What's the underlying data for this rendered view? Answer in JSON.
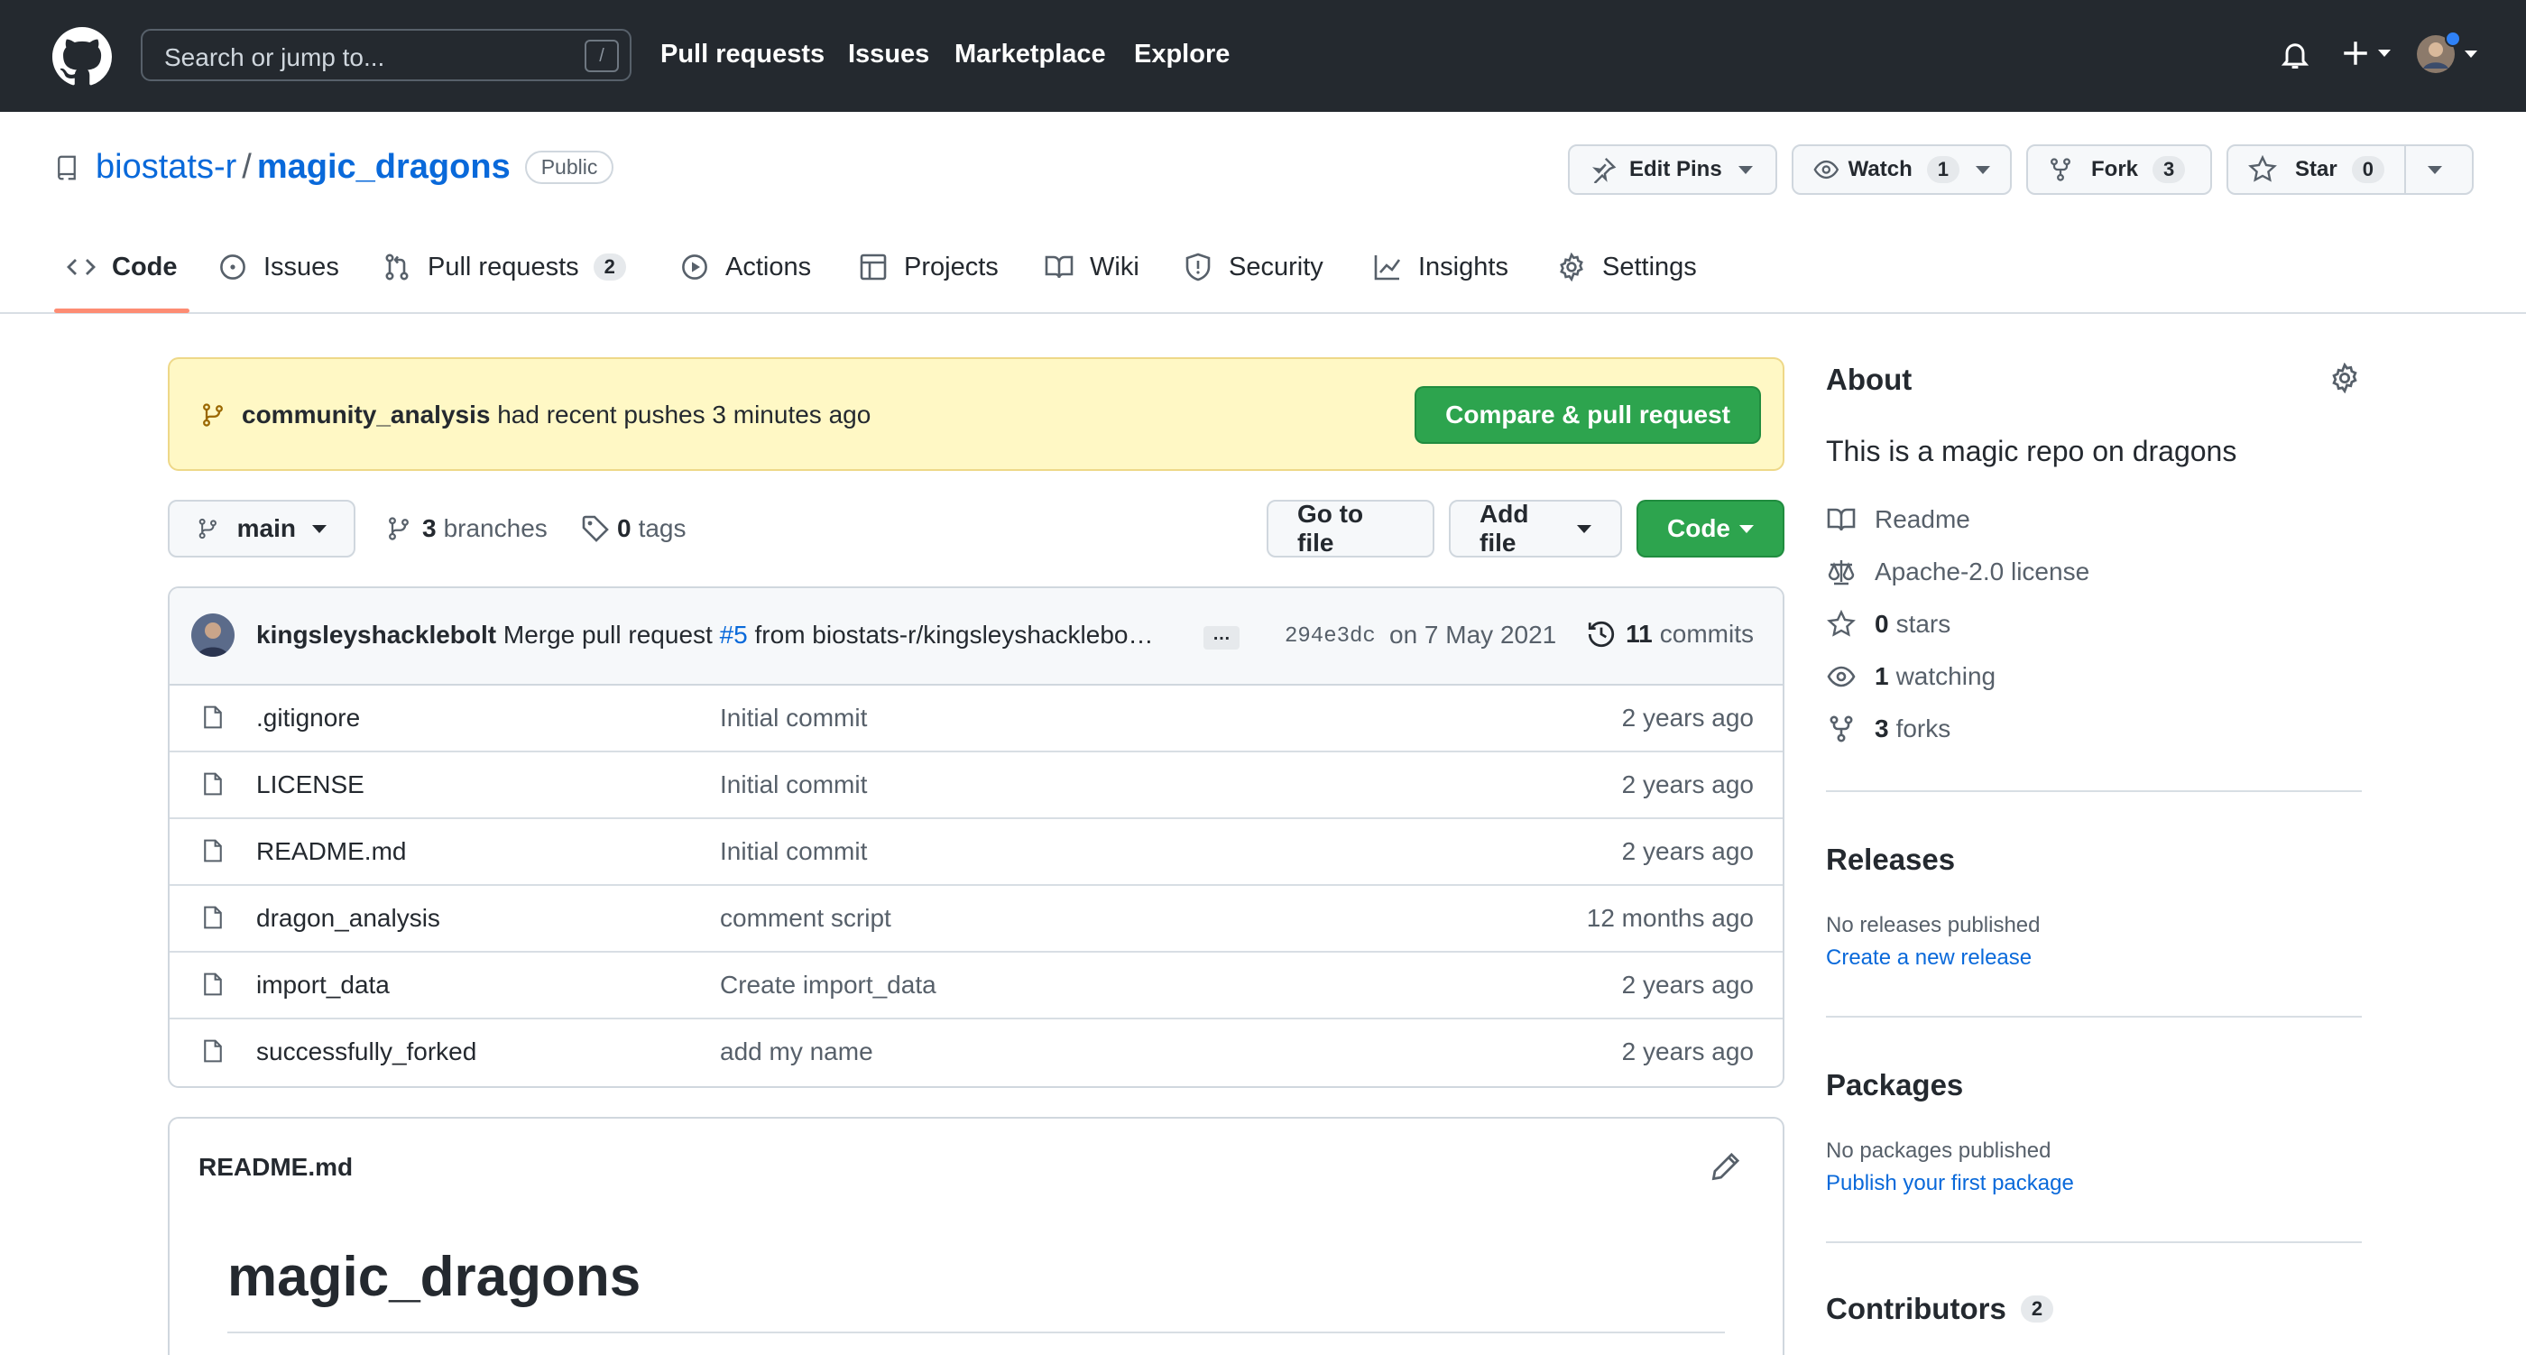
{
  "header": {
    "search_placeholder": "Search or jump to...",
    "search_shortcut": "/",
    "nav": [
      "Pull requests",
      "Issues",
      "Marketplace",
      "Explore"
    ]
  },
  "repo": {
    "owner": "biostats-r",
    "name": "magic_dragons",
    "visibility": "Public",
    "actions": {
      "edit_pins": "Edit Pins",
      "watch_label": "Watch",
      "watch_count": "1",
      "fork_label": "Fork",
      "fork_count": "3",
      "star_label": "Star",
      "star_count": "0"
    }
  },
  "tabs": [
    {
      "label": "Code",
      "icon": "code-icon"
    },
    {
      "label": "Issues",
      "icon": "issue-icon"
    },
    {
      "label": "Pull requests",
      "icon": "pull-request-icon",
      "count": "2"
    },
    {
      "label": "Actions",
      "icon": "play-icon"
    },
    {
      "label": "Projects",
      "icon": "table-icon"
    },
    {
      "label": "Wiki",
      "icon": "book-icon"
    },
    {
      "label": "Security",
      "icon": "shield-icon"
    },
    {
      "label": "Insights",
      "icon": "graph-icon"
    },
    {
      "label": "Settings",
      "icon": "gear-icon"
    }
  ],
  "banner": {
    "branch": "community_analysis",
    "text": "had recent pushes 3 minutes ago",
    "button": "Compare & pull request"
  },
  "file_nav": {
    "branch": "main",
    "branches_count": "3",
    "branches_label": "branches",
    "tags_count": "0",
    "tags_label": "tags",
    "go_to_file": "Go to file",
    "add_file": "Add file",
    "code": "Code"
  },
  "latest_commit": {
    "author": "kingsleyshacklebolt",
    "message_prefix": "Merge pull request",
    "pr_link": "#5",
    "message_suffix": "from biostats-r/kingsleyshacklebo…",
    "ellipsis": "…",
    "sha": "294e3dc",
    "date": "on 7 May 2021",
    "commits_count": "11",
    "commits_label": "commits"
  },
  "files": [
    {
      "name": ".gitignore",
      "message": "Initial commit",
      "age": "2 years ago"
    },
    {
      "name": "LICENSE",
      "message": "Initial commit",
      "age": "2 years ago"
    },
    {
      "name": "README.md",
      "message": "Initial commit",
      "age": "2 years ago"
    },
    {
      "name": "dragon_analysis",
      "message": "comment script",
      "age": "12 months ago"
    },
    {
      "name": "import_data",
      "message": "Create import_data",
      "age": "2 years ago"
    },
    {
      "name": "successfully_forked",
      "message": "add my name",
      "age": "2 years ago"
    }
  ],
  "readme": {
    "filename": "README.md",
    "heading": "magic_dragons"
  },
  "about": {
    "title": "About",
    "description": "This is a magic repo on dragons",
    "readme": "Readme",
    "license": "Apache-2.0 license",
    "stars_count": "0",
    "stars_label": "stars",
    "watching_count": "1",
    "watching_label": "watching",
    "forks_count": "3",
    "forks_label": "forks"
  },
  "releases": {
    "title": "Releases",
    "empty": "No releases published",
    "link": "Create a new release"
  },
  "packages": {
    "title": "Packages",
    "empty": "No packages published",
    "link": "Publish your first package"
  },
  "contributors": {
    "title": "Contributors",
    "count": "2"
  }
}
